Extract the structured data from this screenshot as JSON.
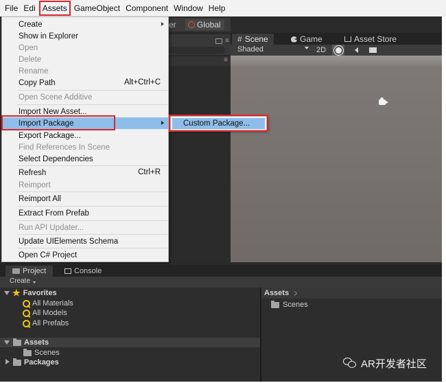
{
  "menubar": {
    "items": [
      "File",
      "Edi",
      "Assets",
      "GameObject",
      "Component",
      "Window",
      "Help"
    ]
  },
  "hierarchy": {
    "tab_fragment": "er",
    "global_label": "Global"
  },
  "scene": {
    "tabs": [
      "Scene",
      "Game",
      "Asset Store"
    ],
    "shading_mode": "Shaded",
    "toggle_2d": "2D"
  },
  "assets_menu": {
    "items": [
      {
        "label": "Create",
        "submenu": true,
        "enabled": true
      },
      {
        "label": "Show in Explorer",
        "enabled": true
      },
      {
        "label": "Open",
        "enabled": false
      },
      {
        "label": "Delete",
        "enabled": false
      },
      {
        "label": "Rename",
        "enabled": false
      },
      {
        "label": "Copy Path",
        "shortcut": "Alt+Ctrl+C",
        "enabled": true
      },
      {
        "label": "Open Scene Additive",
        "enabled": false
      },
      {
        "label": "Import New Asset...",
        "enabled": true
      },
      {
        "label": "Import Package",
        "submenu": true,
        "enabled": true,
        "highlighted": true
      },
      {
        "label": "Export Package...",
        "enabled": true
      },
      {
        "label": "Find References In Scene",
        "enabled": false
      },
      {
        "label": "Select Dependencies",
        "enabled": true
      },
      {
        "label": "Refresh",
        "shortcut": "Ctrl+R",
        "enabled": true
      },
      {
        "label": "Reimport",
        "enabled": false
      },
      {
        "label": "Reimport All",
        "enabled": true
      },
      {
        "label": "Extract From Prefab",
        "enabled": true
      },
      {
        "label": "Run API Updater...",
        "enabled": false
      },
      {
        "label": "Update UIElements Schema",
        "enabled": true
      },
      {
        "label": "Open C# Project",
        "enabled": true
      }
    ]
  },
  "submenu": {
    "item": "Custom Package..."
  },
  "bottom": {
    "tabs": [
      "Project",
      "Console"
    ],
    "create_label": "Create",
    "tree": {
      "favorites": "Favorites",
      "favorite_items": [
        "All Materials",
        "All Models",
        "All Prefabs"
      ],
      "assets": "Assets",
      "assets_children": [
        "Scenes"
      ],
      "packages": "Packages"
    },
    "breadcrumb": "Assets",
    "asset_items": [
      "Scenes"
    ]
  },
  "watermark": {
    "text": "AR开发者社区"
  },
  "colors": {
    "highlight": "#8fbde9",
    "annotation_red": "#d9252a",
    "favorites_star": "#f0c419"
  }
}
